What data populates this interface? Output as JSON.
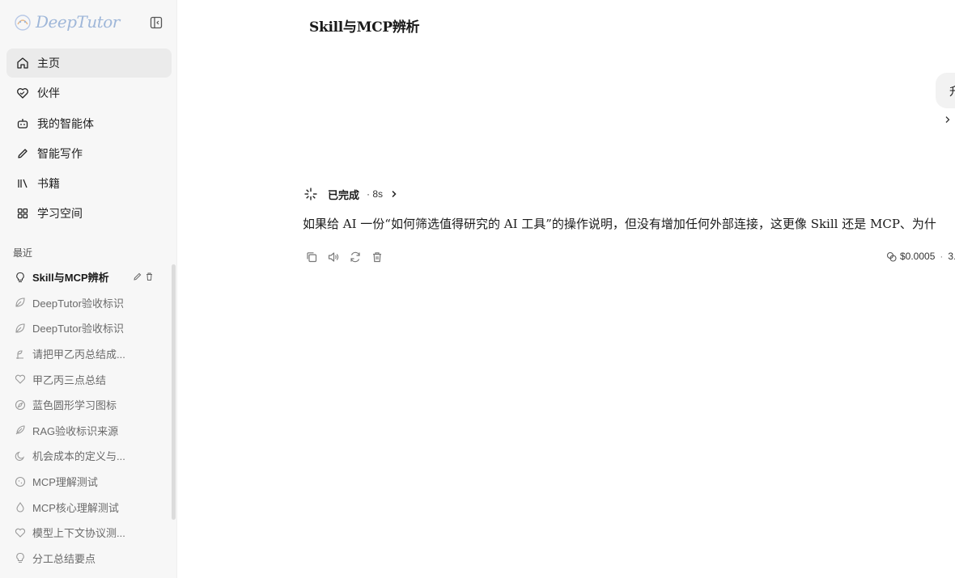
{
  "app": {
    "logo_text": "DeepTutor",
    "collapse_icon": "sidebar-collapse-icon"
  },
  "nav": {
    "items": [
      {
        "label": "主页",
        "icon": "home-icon",
        "active": true
      },
      {
        "label": "伙伴",
        "icon": "heart-handshake-icon",
        "active": false
      },
      {
        "label": "我的智能体",
        "icon": "bot-icon",
        "active": false
      },
      {
        "label": "智能写作",
        "icon": "pen-icon",
        "active": false
      },
      {
        "label": "书籍",
        "icon": "library-icon",
        "active": false
      },
      {
        "label": "学习空间",
        "icon": "grid-icon",
        "active": false
      }
    ]
  },
  "recent": {
    "section_label": "最近",
    "items": [
      {
        "label": "Skill与MCP辨析",
        "icon": "lightbulb-icon",
        "active": true
      },
      {
        "label": "DeepTutor验收标识",
        "icon": "leaf-icon",
        "active": false
      },
      {
        "label": "DeepTutor验收标识",
        "icon": "leaf-icon",
        "active": false
      },
      {
        "label": "请把甲乙丙总结成...",
        "icon": "sprout-icon",
        "active": false
      },
      {
        "label": "甲乙丙三点总结",
        "icon": "heart-icon",
        "active": false
      },
      {
        "label": "蓝色圆形学习图标",
        "icon": "compass-icon",
        "active": false
      },
      {
        "label": "RAG验收标识来源",
        "icon": "feather-icon",
        "active": false
      },
      {
        "label": "机会成本的定义与...",
        "icon": "moon-icon",
        "active": false
      },
      {
        "label": "MCP理解测试",
        "icon": "cookie-icon",
        "active": false
      },
      {
        "label": "MCP核心理解测试",
        "icon": "droplet-icon",
        "active": false
      },
      {
        "label": "模型上下文协议测...",
        "icon": "heart-icon",
        "active": false
      },
      {
        "label": "分工总结要点",
        "icon": "lightbulb-icon",
        "active": false
      }
    ]
  },
  "chat": {
    "title": "Skill与MCP辨析",
    "user_message_visible": "升",
    "status": "已完成",
    "duration": "· 8s",
    "answer": "如果给 AI 一份“如何筛选值得研究的 AI 工具”的操作说明，但没有增加任何外部连接，这更像 Skill 还是 MCP、为什",
    "cost": "$0.0005",
    "cost_sep": "·",
    "tokens_partial": "3."
  },
  "colors": {
    "sidebar_bg": "#f7f7f7",
    "active_item_bg": "#ebebeb",
    "logo": "#9fb7d9",
    "bubble_bg": "#f2f2f2"
  }
}
